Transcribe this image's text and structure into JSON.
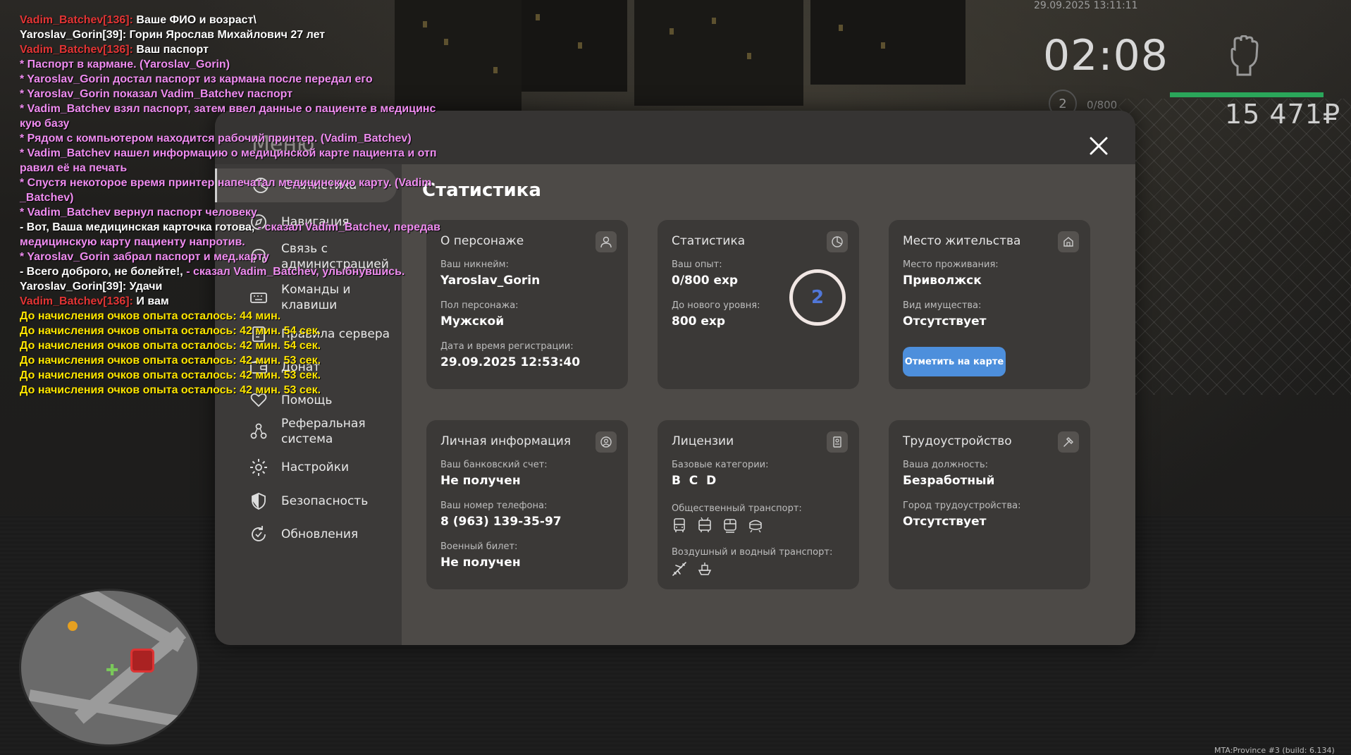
{
  "hud": {
    "datetime": "29.09.2025 13:11:11",
    "time": "02:08",
    "level": "2",
    "exp": "0/800",
    "exp_progress": 0.0,
    "hp_progress": 1.0,
    "money": "15 471₽",
    "build": "MTA:Province #3 (build: 6.134)"
  },
  "chat": [
    {
      "parts": [
        {
          "c": "red",
          "t": "Vadim_Batchev[136]: "
        },
        {
          "c": "white",
          "t": "Ваше ФИО и возраст\\"
        }
      ]
    },
    {
      "parts": [
        {
          "c": "white",
          "t": "Yaroslav_Gorin[39]: Горин Ярослав Михайлович 27 лет"
        }
      ]
    },
    {
      "parts": [
        {
          "c": "red",
          "t": "Vadim_Batchev[136]: "
        },
        {
          "c": "white",
          "t": "Ваш паспорт"
        }
      ]
    },
    {
      "parts": [
        {
          "c": "pink",
          "t": "* Паспорт в кармане. (Yaroslav_Gorin)"
        }
      ]
    },
    {
      "parts": [
        {
          "c": "pink",
          "t": "* Yaroslav_Gorin достал паспорт из кармана после передал его"
        }
      ]
    },
    {
      "parts": [
        {
          "c": "pink",
          "t": "* Yaroslav_Gorin показал Vadim_Batchev паспорт"
        }
      ]
    },
    {
      "parts": [
        {
          "c": "pink",
          "t": "* Vadim_Batchev взял паспорт, затем ввел данные о пациенте в медицинс\nкую базу"
        }
      ]
    },
    {
      "parts": [
        {
          "c": "pink",
          "t": "* Рядом с компьютером находится рабочий принтер. (Vadim_Batchev)"
        }
      ]
    },
    {
      "parts": [
        {
          "c": "pink",
          "t": "* Vadim_Batchev нашел информацию о медицинской карте пациента и отп\nравил её на печать"
        }
      ]
    },
    {
      "parts": [
        {
          "c": "pink",
          "t": "* Спустя некоторое время принтер напечатал медицинскую карту. (Vadim\n_Batchev)"
        }
      ]
    },
    {
      "parts": [
        {
          "c": "pink",
          "t": "* Vadim_Batchev вернул паспорт человеку"
        }
      ]
    },
    {
      "parts": [
        {
          "c": "white",
          "t": "- Вот, Ваша медицинская карточка готова, "
        },
        {
          "c": "pink",
          "t": "- сказал Vadim_Batchev, передав\nмедицинскую карту пациенту напротив."
        }
      ]
    },
    {
      "parts": [
        {
          "c": "pink",
          "t": "* Yaroslav_Gorin забрал паспорт и мед.карту"
        }
      ]
    },
    {
      "parts": [
        {
          "c": "white",
          "t": "- Всего доброго, не болейте!, "
        },
        {
          "c": "pink",
          "t": "- сказал Vadim_Batchev, улыбнувшись."
        }
      ]
    },
    {
      "parts": [
        {
          "c": "white",
          "t": "Yaroslav_Gorin[39]: Удачи"
        }
      ]
    },
    {
      "parts": [
        {
          "c": "red",
          "t": "Vadim_Batchev[136]: "
        },
        {
          "c": "white",
          "t": "И вам"
        }
      ]
    },
    {
      "parts": [
        {
          "c": "yellow",
          "t": "До начисления очков опыта осталось: 44 мин."
        }
      ]
    },
    {
      "parts": [
        {
          "c": "yellow",
          "t": "До начисления очков опыта осталось: 42 мин. 54 сек."
        }
      ]
    },
    {
      "parts": [
        {
          "c": "yellow",
          "t": "До начисления очков опыта осталось: 42 мин. 54 сек."
        }
      ]
    },
    {
      "parts": [
        {
          "c": "yellow",
          "t": "До начисления очков опыта осталось: 42 мин. 53 сек."
        }
      ]
    },
    {
      "parts": [
        {
          "c": "yellow",
          "t": "До начисления очков опыта осталось: 42 мин. 53 сек."
        }
      ]
    },
    {
      "parts": [
        {
          "c": "yellow",
          "t": "До начисления очков опыта осталось: 42 мин. 53 сек."
        }
      ]
    }
  ],
  "menu": {
    "title": "Меню",
    "section_title": "Статистика",
    "sidebar": [
      {
        "label": "Статистика",
        "icon": "pie-chart-icon",
        "active": true
      },
      {
        "label": "Навигация",
        "icon": "compass-icon",
        "active": false
      },
      {
        "label": "Связь с\nадминистрацией",
        "icon": "headset-icon",
        "active": false
      },
      {
        "label": "Команды и\nклавиши",
        "icon": "keyboard-icon",
        "active": false
      },
      {
        "label": "Правила сервера",
        "icon": "rules-icon",
        "active": false
      },
      {
        "label": "Донат",
        "icon": "wallet-icon",
        "active": false
      },
      {
        "label": "Помощь",
        "icon": "heart-hand-icon",
        "active": false
      },
      {
        "label": "Реферальная\nсистема",
        "icon": "referral-icon",
        "active": false
      },
      {
        "label": "Настройки",
        "icon": "gear-icon",
        "active": false
      },
      {
        "label": "Безопасность",
        "icon": "shield-icon",
        "active": false
      },
      {
        "label": "Обновления",
        "icon": "refresh-icon",
        "active": false
      }
    ],
    "cards": {
      "character": {
        "title": "О персонаже",
        "nickname_label": "Ваш никнейм:",
        "nickname": "Yaroslav_Gorin",
        "gender_label": "Пол персонажа:",
        "gender": "Мужской",
        "reg_label": "Дата и время регистрации:",
        "reg": "29.09.2025 12:53:40"
      },
      "stats": {
        "title": "Статистика",
        "exp_label": "Ваш опыт:",
        "exp": "0/800 exp",
        "next_label": "До нового уровня:",
        "next": "800 exp",
        "level": "2"
      },
      "residence": {
        "title": "Место жительства",
        "place_label": "Место проживания:",
        "place": "Приволжск",
        "property_label": "Вид имущества:",
        "property": "Отсутствует",
        "button": "Отметить на карте"
      },
      "personal": {
        "title": "Личная информация",
        "bank_label": "Ваш банковский счет:",
        "bank": "Не получен",
        "phone_label": "Ваш номер телефона:",
        "phone": "8 (963) 139-35-97",
        "military_label": "Военный билет:",
        "military": "Не получен"
      },
      "licenses": {
        "title": "Лицензии",
        "base_label": "Базовые категории:",
        "base": "B  C  D",
        "public_label": "Общественный транспорт:",
        "public_icons": [
          "bus-icon",
          "trolleybus-icon",
          "tram-icon",
          "metro-icon"
        ],
        "air_label": "Воздушный и водный транспорт:",
        "air_icons": [
          "airplane-icon",
          "boat-icon"
        ]
      },
      "job": {
        "title": "Трудоустройство",
        "position_label": "Ваша должность:",
        "position": "Безработный",
        "city_label": "Город трудоустройства:",
        "city": "Отсутствует"
      }
    }
  }
}
